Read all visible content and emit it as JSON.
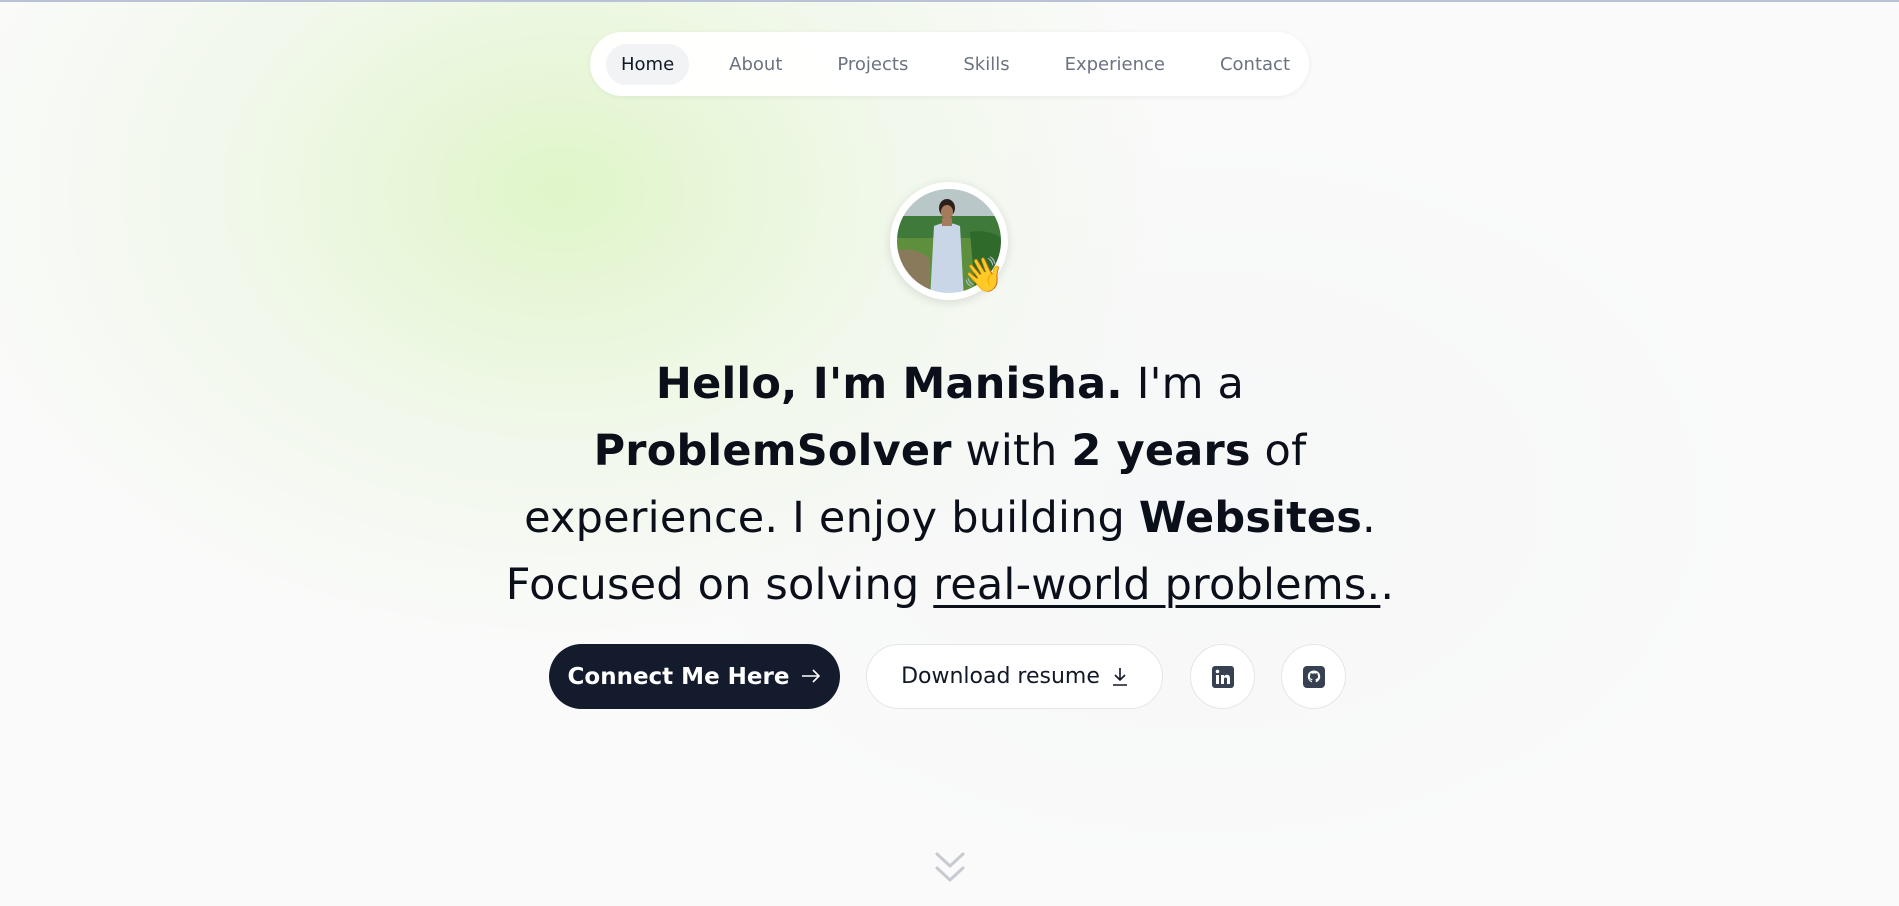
{
  "nav": {
    "items": [
      {
        "label": "Home",
        "active": true
      },
      {
        "label": "About",
        "active": false
      },
      {
        "label": "Projects",
        "active": false
      },
      {
        "label": "Skills",
        "active": false
      },
      {
        "label": "Experience",
        "active": false
      },
      {
        "label": "Contact",
        "active": false
      }
    ]
  },
  "hero": {
    "avatar_icon": "profile-photo",
    "wave_emoji": "👋",
    "headline": {
      "greeting": "Hello, I'm Manisha.",
      "im_a": " I'm a ",
      "role": "ProblemSolver",
      "with": " with ",
      "years": "2 years",
      "experience": " of experience. I enjoy building ",
      "websites": "Websites",
      "focused": ". Focused on solving ",
      "underlined": "real-world problems.",
      "end": "."
    }
  },
  "actions": {
    "connect_label": "Connect Me Here",
    "connect_icon": "arrow-right-icon",
    "resume_label": "Download resume",
    "resume_icon": "download-icon",
    "linkedin_icon": "linkedin-icon",
    "github_icon": "github-icon"
  },
  "scroll_icon": "chevrons-down-icon",
  "colors": {
    "primary_button": "#141b2d",
    "accent_glow": "#def5c6",
    "icon_dark": "#374151"
  }
}
